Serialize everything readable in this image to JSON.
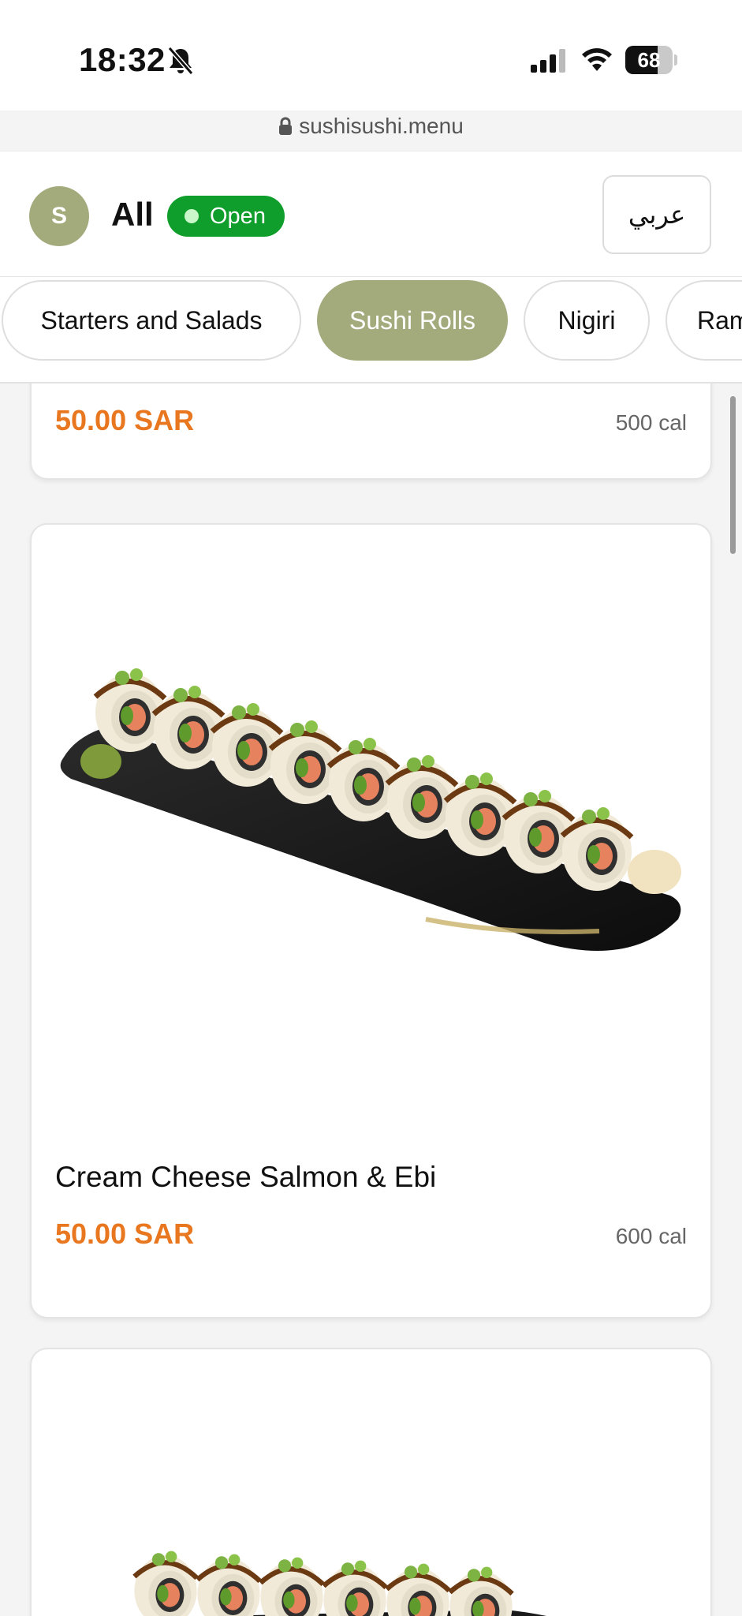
{
  "status_bar": {
    "time": "18:32",
    "icons": [
      "bell-off-icon",
      "signal-icon",
      "wifi-icon",
      "battery-icon"
    ],
    "battery_level": "68",
    "battery_fraction": 0.68
  },
  "browser": {
    "url": "sushisushi.menu"
  },
  "header": {
    "avatar_letter": "S",
    "title": "All",
    "status_label": "Open",
    "status_color": "#0f9d2b",
    "language_button": "عربي"
  },
  "tabs": [
    {
      "label": "Starters and Salads",
      "active": false
    },
    {
      "label": "Sushi Rolls",
      "active": true
    },
    {
      "label": "Nigiri",
      "active": false
    },
    {
      "label": "Ram",
      "active": false
    }
  ],
  "accent_color": "#a3ab7d",
  "price_color": "#e8771f",
  "items": [
    {
      "name": "",
      "price": "50.00 SAR",
      "calories": "500 cal"
    },
    {
      "name": "Cream Cheese Salmon & Ebi",
      "price": "50.00 SAR",
      "calories": "600 cal"
    },
    {
      "name": "",
      "price": "",
      "calories": ""
    }
  ]
}
